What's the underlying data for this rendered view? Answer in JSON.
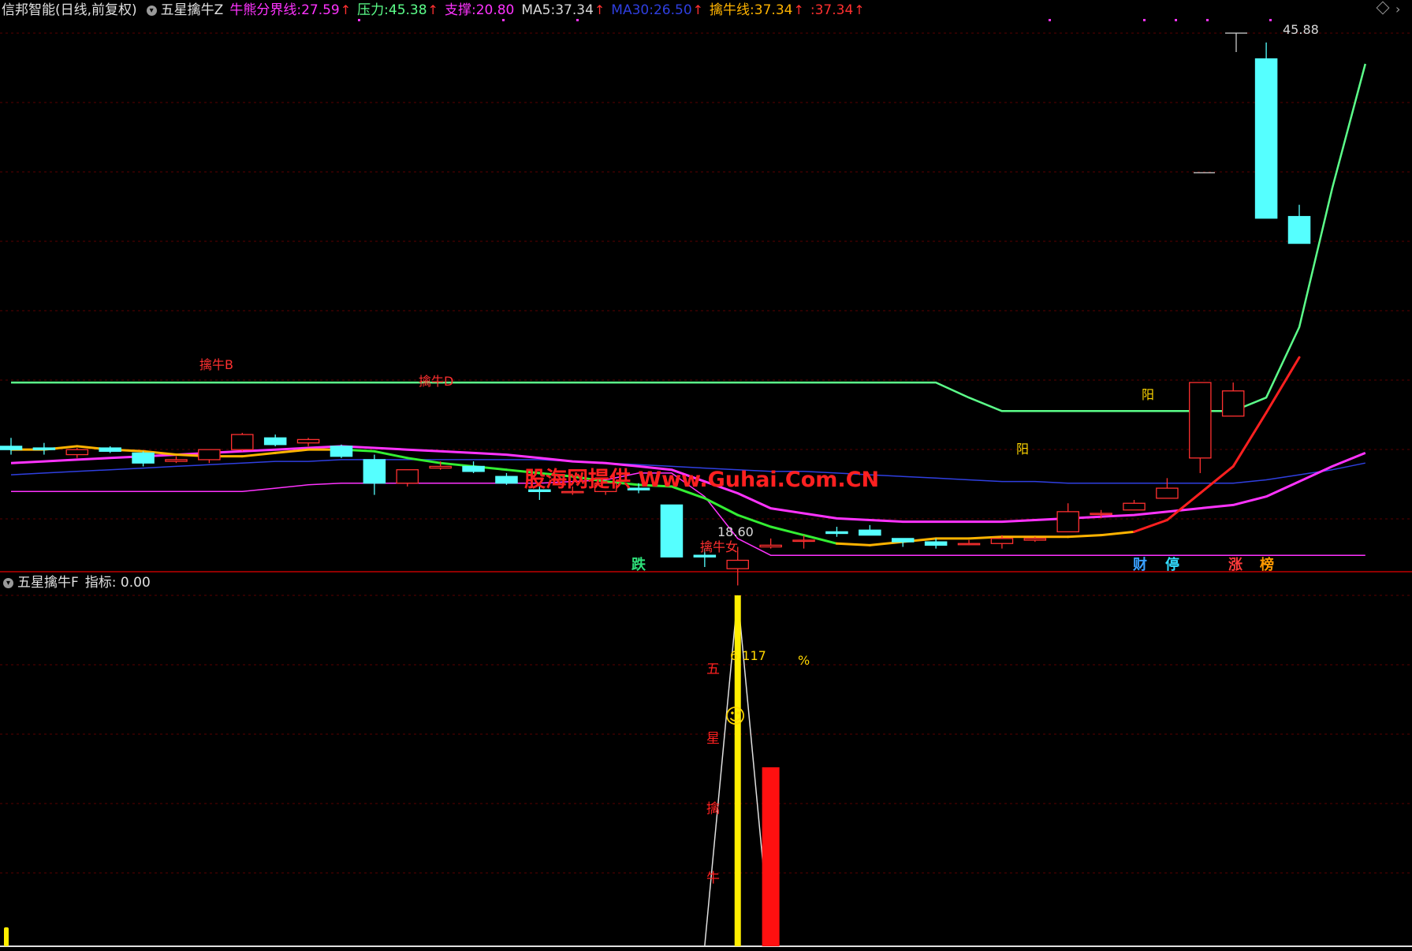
{
  "upper_header": {
    "app": "信邦智能(日线,前复权)",
    "indicator": "五星擒牛Z",
    "items": [
      {
        "label": "牛熊分界线",
        "value": "27.59",
        "color": "#ff33ff",
        "arrow": "↑"
      },
      {
        "label": "压力",
        "value": "45.38",
        "color": "#5cff8a",
        "arrow": "↑"
      },
      {
        "label": "支撑",
        "value": "20.80",
        "color": "#ff33ff",
        "arrow": ""
      },
      {
        "label": "MA5",
        "value": "37.34",
        "color": "#d8d8d8",
        "arrow": "↑"
      },
      {
        "label": "MA30",
        "value": "26.50",
        "color": "#2f3fe0",
        "arrow": "↑"
      },
      {
        "label": "擒牛线",
        "value": "37.34",
        "color": "#ffb300",
        "arrow": "↑"
      },
      {
        "label": "",
        "value": "37.34",
        "color": "#ff3030",
        "arrow": "↑"
      }
    ]
  },
  "lower_header": {
    "indicator": "五星擒牛F",
    "label": "指标",
    "value": "0.00"
  },
  "watermark": "股海网提供 Www.Guhai.Com.CN",
  "annotations": {
    "high_label": "45.88",
    "low_label": "18.60",
    "qinniu_b": "擒牛B",
    "qinniu_d": "擒牛D",
    "qinniu_zhuang": "擒牛女",
    "yang1": "阳",
    "yang2": "阳",
    "pct_value": "6.117",
    "pct_sign": "%",
    "smile": "☺",
    "vert_text": [
      "五",
      "星",
      "擒",
      "牛"
    ]
  },
  "bottom_markers": [
    {
      "text": "跌",
      "color": "#2ee07a"
    },
    {
      "text": "财",
      "color": "#3aa0ff"
    },
    {
      "text": "停",
      "color": "#33ddff"
    },
    {
      "text": "涨",
      "color": "#ff3b3b"
    },
    {
      "text": "榜",
      "color": "#ff9900"
    }
  ],
  "colors": {
    "up": "#ff3030",
    "down": "#55ffff",
    "pressure": "#5cff8a",
    "support": "#ff33ff",
    "ma30": "#2f3fe0",
    "qinniu": "#ffb300",
    "grid": "#5a0000",
    "separator": "#c00000"
  },
  "chart_data": [
    {
      "type": "candlestick",
      "title": "五星擒牛Z",
      "price_range": [
        17,
        47
      ],
      "candles": [
        {
          "o": 21.8,
          "h": 22.3,
          "c": 21.6,
          "l": 21.3
        },
        {
          "o": 21.7,
          "h": 22.0,
          "c": 21.6,
          "l": 21.3
        },
        {
          "o": 21.3,
          "h": 21.7,
          "c": 21.6,
          "l": 21.1
        },
        {
          "o": 21.7,
          "h": 21.8,
          "c": 21.5,
          "l": 21.4
        },
        {
          "o": 21.4,
          "h": 21.5,
          "c": 20.8,
          "l": 20.6
        },
        {
          "o": 20.9,
          "h": 21.2,
          "c": 21.0,
          "l": 20.8
        },
        {
          "o": 21.0,
          "h": 21.6,
          "c": 21.6,
          "l": 20.8
        },
        {
          "o": 21.6,
          "h": 22.6,
          "c": 22.5,
          "l": 21.5
        },
        {
          "o": 22.3,
          "h": 22.5,
          "c": 21.9,
          "l": 21.8
        },
        {
          "o": 22.0,
          "h": 22.3,
          "c": 22.2,
          "l": 21.8
        },
        {
          "o": 21.8,
          "h": 21.9,
          "c": 21.2,
          "l": 21.1
        },
        {
          "o": 21.0,
          "h": 21.3,
          "c": 19.6,
          "l": 18.9
        },
        {
          "o": 19.6,
          "h": 20.2,
          "c": 20.4,
          "l": 19.4
        },
        {
          "o": 20.5,
          "h": 20.9,
          "c": 20.6,
          "l": 20.4
        },
        {
          "o": 20.6,
          "h": 20.9,
          "c": 20.3,
          "l": 20.2
        },
        {
          "o": 20.0,
          "h": 20.2,
          "c": 19.6,
          "l": 19.5
        },
        {
          "o": 19.2,
          "h": 19.5,
          "c": 19.1,
          "l": 18.6
        },
        {
          "o": 19.1,
          "h": 19.4,
          "c": 19.1,
          "l": 18.9
        },
        {
          "o": 19.1,
          "h": 19.6,
          "c": 19.6,
          "l": 18.9
        },
        {
          "o": 19.3,
          "h": 19.6,
          "c": 19.2,
          "l": 19.0
        },
        {
          "o": 18.3,
          "h": 18.3,
          "c": 15.2,
          "l": 15.2
        },
        {
          "o": 15.3,
          "h": 15.7,
          "c": 15.2,
          "l": 14.6
        },
        {
          "o": 14.5,
          "h": 15.8,
          "c": 15.0,
          "l": 13.5
        },
        {
          "o": 15.8,
          "h": 16.3,
          "c": 15.9,
          "l": 15.7
        },
        {
          "o": 16.2,
          "h": 16.5,
          "c": 16.2,
          "l": 15.7
        },
        {
          "o": 16.7,
          "h": 17.0,
          "c": 16.6,
          "l": 16.4
        },
        {
          "o": 16.8,
          "h": 17.1,
          "c": 16.5,
          "l": 16.5
        },
        {
          "o": 16.3,
          "h": 16.3,
          "c": 16.1,
          "l": 15.8
        },
        {
          "o": 16.1,
          "h": 16.3,
          "c": 15.9,
          "l": 15.7
        },
        {
          "o": 16.0,
          "h": 16.2,
          "c": 16.0,
          "l": 15.9
        },
        {
          "o": 16.0,
          "h": 16.5,
          "c": 16.3,
          "l": 15.7
        },
        {
          "o": 16.2,
          "h": 16.4,
          "c": 16.3,
          "l": 16.1
        },
        {
          "o": 16.7,
          "h": 18.4,
          "c": 17.9,
          "l": 16.7
        },
        {
          "o": 17.8,
          "h": 18.0,
          "c": 17.8,
          "l": 17.5
        },
        {
          "o": 18.0,
          "h": 18.6,
          "c": 18.4,
          "l": 18.0
        },
        {
          "o": 18.7,
          "h": 19.9,
          "c": 19.3,
          "l": 18.7
        },
        {
          "o": 21.1,
          "h": 24.2,
          "c": 25.6,
          "l": 20.2
        },
        {
          "o": 23.6,
          "h": 25.6,
          "c": 25.1,
          "l": 23.6
        },
        {
          "o": 44.9,
          "h": 45.88,
          "c": 35.4,
          "l": 35.4
        },
        {
          "o": 35.5,
          "h": 36.2,
          "c": 33.9,
          "l": 33.9
        }
      ],
      "series": [
        {
          "name": "压力",
          "values": [
            25.6,
            25.6,
            25.6,
            25.6,
            25.6,
            25.6,
            25.6,
            25.6,
            25.6,
            25.6,
            25.6,
            25.6,
            25.6,
            25.6,
            25.6,
            25.6,
            25.6,
            25.6,
            25.6,
            25.6,
            25.6,
            25.6,
            25.6,
            25.6,
            25.6,
            25.6,
            25.6,
            25.6,
            25.6,
            24.7,
            23.9,
            23.9,
            23.9,
            23.9,
            23.9,
            23.9,
            23.9,
            23.9,
            24.7,
            28.9,
            37.2,
            44.6
          ]
        },
        {
          "name": "牛熊分界线",
          "values": [
            20.8,
            20.9,
            21.0,
            21.1,
            21.2,
            21.3,
            21.4,
            21.5,
            21.6,
            21.7,
            21.8,
            21.7,
            21.6,
            21.5,
            21.4,
            21.3,
            21.1,
            20.9,
            20.8,
            20.6,
            20.4,
            19.7,
            19.0,
            18.1,
            17.8,
            17.5,
            17.4,
            17.3,
            17.3,
            17.3,
            17.3,
            17.4,
            17.5,
            17.6,
            17.7,
            17.9,
            18.1,
            18.3,
            18.8,
            19.7,
            20.6,
            21.4
          ]
        },
        {
          "name": "MA30",
          "values": [
            20.1,
            20.2,
            20.3,
            20.4,
            20.5,
            20.6,
            20.7,
            20.8,
            20.9,
            20.9,
            21.0,
            21.0,
            21.0,
            21.0,
            21.0,
            21.0,
            21.0,
            20.9,
            20.8,
            20.7,
            20.6,
            20.5,
            20.4,
            20.3,
            20.3,
            20.2,
            20.1,
            20.0,
            19.9,
            19.8,
            19.7,
            19.7,
            19.6,
            19.6,
            19.6,
            19.6,
            19.6,
            19.6,
            19.8,
            20.1,
            20.4,
            20.8
          ]
        },
        {
          "name": "支撑",
          "values": [
            19.1,
            19.1,
            19.1,
            19.1,
            19.1,
            19.1,
            19.1,
            19.1,
            19.3,
            19.5,
            19.6,
            19.6,
            19.6,
            19.6,
            19.6,
            19.6,
            19.6,
            19.7,
            19.8,
            20.2,
            20.2,
            18.8,
            16.3,
            15.3,
            15.3,
            15.3,
            15.3,
            15.3,
            15.3,
            15.3,
            15.3,
            15.3,
            15.3,
            15.3,
            15.3,
            15.3,
            15.3,
            15.3,
            15.3,
            15.3,
            15.3,
            15.3
          ]
        },
        {
          "name": "MA5",
          "values": [
            21.6,
            21.6,
            21.8,
            21.6,
            21.5,
            21.3,
            21.2,
            21.2,
            21.4,
            21.6,
            21.6,
            21.5,
            21.1,
            20.8,
            20.6,
            20.4,
            20.2,
            20.0,
            19.7,
            19.5,
            19.4,
            18.7,
            17.7,
            17.0,
            16.5,
            16.0,
            15.9,
            16.1,
            16.3,
            16.3,
            16.4,
            16.4,
            16.4,
            16.5,
            16.7,
            17.4,
            19.0,
            20.6,
            23.8,
            27.1,
            31.5,
            37.3
          ]
        },
        {
          "name": "擒牛线",
          "values": [
            21.6,
            21.6,
            21.8,
            21.6,
            21.5,
            21.3,
            21.2,
            21.2,
            21.4,
            21.6,
            21.6,
            21.5,
            21.1,
            20.8,
            20.6,
            20.4,
            20.2,
            20.0,
            19.7,
            19.5,
            19.4,
            18.7,
            17.7,
            17.0,
            16.5,
            16.0,
            15.9,
            16.1,
            16.3,
            16.3,
            16.4,
            16.4,
            16.4,
            16.5,
            16.7,
            17.4,
            19.0,
            20.6,
            23.8,
            27.1,
            31.5,
            37.3
          ]
        }
      ]
    },
    {
      "type": "bar",
      "title": "五星擒牛F",
      "series": [
        {
          "name": "指标",
          "values": [
            0,
            0,
            0,
            0,
            0,
            0,
            0,
            0,
            0,
            0,
            0,
            0,
            0,
            0,
            0,
            0,
            0,
            0,
            0,
            0,
            0,
            0,
            100,
            0,
            0,
            0,
            0,
            0,
            0,
            0,
            0,
            0,
            0,
            0,
            0,
            0,
            0,
            0,
            0,
            0,
            0,
            0
          ]
        },
        {
          "name": "red",
          "values": [
            0,
            0,
            0,
            0,
            0,
            0,
            0,
            0,
            0,
            0,
            0,
            0,
            0,
            0,
            0,
            0,
            0,
            0,
            0,
            0,
            0,
            0,
            0,
            51,
            0,
            0,
            0,
            0,
            0,
            0,
            0,
            0,
            0,
            0,
            0,
            0,
            0,
            0,
            0,
            0,
            0,
            0
          ]
        }
      ]
    }
  ]
}
